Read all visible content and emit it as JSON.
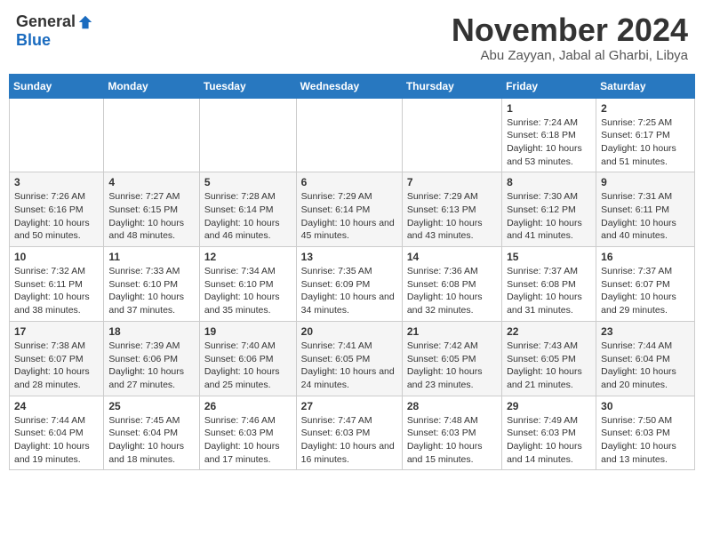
{
  "header": {
    "logo_general": "General",
    "logo_blue": "Blue",
    "month_title": "November 2024",
    "location": "Abu Zayyan, Jabal al Gharbi, Libya"
  },
  "weekdays": [
    "Sunday",
    "Monday",
    "Tuesday",
    "Wednesday",
    "Thursday",
    "Friday",
    "Saturday"
  ],
  "weeks": [
    [
      {
        "day": "",
        "content": ""
      },
      {
        "day": "",
        "content": ""
      },
      {
        "day": "",
        "content": ""
      },
      {
        "day": "",
        "content": ""
      },
      {
        "day": "",
        "content": ""
      },
      {
        "day": "1",
        "content": "Sunrise: 7:24 AM\nSunset: 6:18 PM\nDaylight: 10 hours and 53 minutes."
      },
      {
        "day": "2",
        "content": "Sunrise: 7:25 AM\nSunset: 6:17 PM\nDaylight: 10 hours and 51 minutes."
      }
    ],
    [
      {
        "day": "3",
        "content": "Sunrise: 7:26 AM\nSunset: 6:16 PM\nDaylight: 10 hours and 50 minutes."
      },
      {
        "day": "4",
        "content": "Sunrise: 7:27 AM\nSunset: 6:15 PM\nDaylight: 10 hours and 48 minutes."
      },
      {
        "day": "5",
        "content": "Sunrise: 7:28 AM\nSunset: 6:14 PM\nDaylight: 10 hours and 46 minutes."
      },
      {
        "day": "6",
        "content": "Sunrise: 7:29 AM\nSunset: 6:14 PM\nDaylight: 10 hours and 45 minutes."
      },
      {
        "day": "7",
        "content": "Sunrise: 7:29 AM\nSunset: 6:13 PM\nDaylight: 10 hours and 43 minutes."
      },
      {
        "day": "8",
        "content": "Sunrise: 7:30 AM\nSunset: 6:12 PM\nDaylight: 10 hours and 41 minutes."
      },
      {
        "day": "9",
        "content": "Sunrise: 7:31 AM\nSunset: 6:11 PM\nDaylight: 10 hours and 40 minutes."
      }
    ],
    [
      {
        "day": "10",
        "content": "Sunrise: 7:32 AM\nSunset: 6:11 PM\nDaylight: 10 hours and 38 minutes."
      },
      {
        "day": "11",
        "content": "Sunrise: 7:33 AM\nSunset: 6:10 PM\nDaylight: 10 hours and 37 minutes."
      },
      {
        "day": "12",
        "content": "Sunrise: 7:34 AM\nSunset: 6:10 PM\nDaylight: 10 hours and 35 minutes."
      },
      {
        "day": "13",
        "content": "Sunrise: 7:35 AM\nSunset: 6:09 PM\nDaylight: 10 hours and 34 minutes."
      },
      {
        "day": "14",
        "content": "Sunrise: 7:36 AM\nSunset: 6:08 PM\nDaylight: 10 hours and 32 minutes."
      },
      {
        "day": "15",
        "content": "Sunrise: 7:37 AM\nSunset: 6:08 PM\nDaylight: 10 hours and 31 minutes."
      },
      {
        "day": "16",
        "content": "Sunrise: 7:37 AM\nSunset: 6:07 PM\nDaylight: 10 hours and 29 minutes."
      }
    ],
    [
      {
        "day": "17",
        "content": "Sunrise: 7:38 AM\nSunset: 6:07 PM\nDaylight: 10 hours and 28 minutes."
      },
      {
        "day": "18",
        "content": "Sunrise: 7:39 AM\nSunset: 6:06 PM\nDaylight: 10 hours and 27 minutes."
      },
      {
        "day": "19",
        "content": "Sunrise: 7:40 AM\nSunset: 6:06 PM\nDaylight: 10 hours and 25 minutes."
      },
      {
        "day": "20",
        "content": "Sunrise: 7:41 AM\nSunset: 6:05 PM\nDaylight: 10 hours and 24 minutes."
      },
      {
        "day": "21",
        "content": "Sunrise: 7:42 AM\nSunset: 6:05 PM\nDaylight: 10 hours and 23 minutes."
      },
      {
        "day": "22",
        "content": "Sunrise: 7:43 AM\nSunset: 6:05 PM\nDaylight: 10 hours and 21 minutes."
      },
      {
        "day": "23",
        "content": "Sunrise: 7:44 AM\nSunset: 6:04 PM\nDaylight: 10 hours and 20 minutes."
      }
    ],
    [
      {
        "day": "24",
        "content": "Sunrise: 7:44 AM\nSunset: 6:04 PM\nDaylight: 10 hours and 19 minutes."
      },
      {
        "day": "25",
        "content": "Sunrise: 7:45 AM\nSunset: 6:04 PM\nDaylight: 10 hours and 18 minutes."
      },
      {
        "day": "26",
        "content": "Sunrise: 7:46 AM\nSunset: 6:03 PM\nDaylight: 10 hours and 17 minutes."
      },
      {
        "day": "27",
        "content": "Sunrise: 7:47 AM\nSunset: 6:03 PM\nDaylight: 10 hours and 16 minutes."
      },
      {
        "day": "28",
        "content": "Sunrise: 7:48 AM\nSunset: 6:03 PM\nDaylight: 10 hours and 15 minutes."
      },
      {
        "day": "29",
        "content": "Sunrise: 7:49 AM\nSunset: 6:03 PM\nDaylight: 10 hours and 14 minutes."
      },
      {
        "day": "30",
        "content": "Sunrise: 7:50 AM\nSunset: 6:03 PM\nDaylight: 10 hours and 13 minutes."
      }
    ]
  ]
}
